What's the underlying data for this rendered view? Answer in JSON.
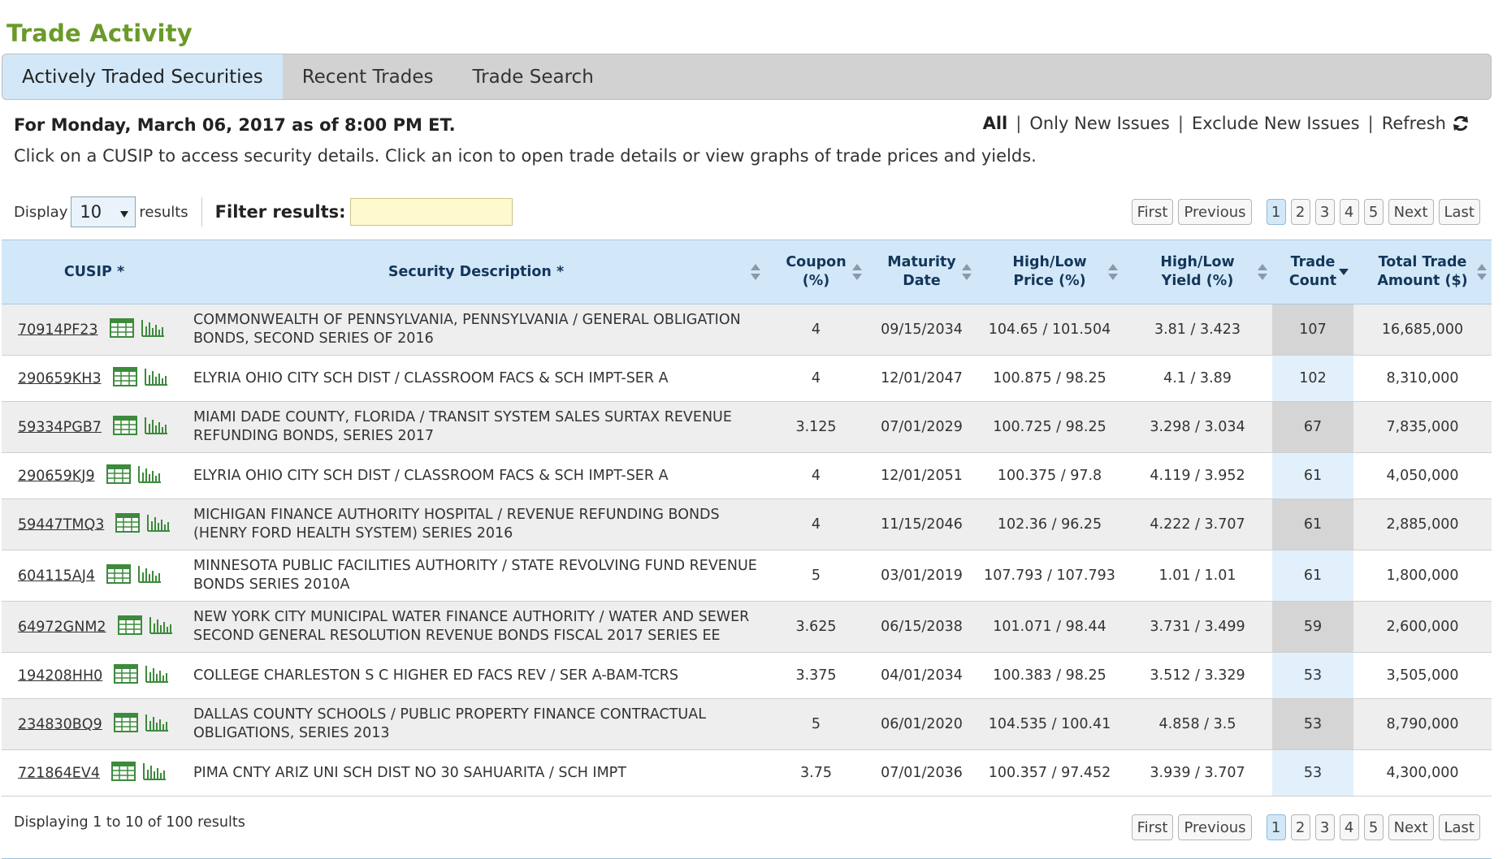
{
  "page": {
    "title": "Trade Activity"
  },
  "tabs": [
    {
      "label": "Actively Traded Securities",
      "active": true
    },
    {
      "label": "Recent Trades",
      "active": false
    },
    {
      "label": "Trade Search",
      "active": false
    }
  ],
  "summary": {
    "date_line": "For Monday, March 06, 2017 as of 8:00 PM ET.",
    "instructions": "Click on a CUSIP to access security details. Click an icon to open trade details or view graphs of trade prices and yields."
  },
  "issue_filter": {
    "all": "All",
    "separator": "|",
    "only_new": "Only New Issues",
    "exclude_new": "Exclude New Issues",
    "refresh": "Refresh",
    "refresh_icon": "refresh-icon"
  },
  "display": {
    "prefix": "Display",
    "selected": "10",
    "suffix": "results",
    "filter_label": "Filter results:",
    "filter_value": ""
  },
  "pagination": {
    "first": "First",
    "previous": "Previous",
    "pages": [
      "1",
      "2",
      "3",
      "4",
      "5"
    ],
    "current": "1",
    "next": "Next",
    "last": "Last"
  },
  "table": {
    "headers": {
      "cusip": "CUSIP *",
      "description": "Security Description *",
      "coupon_1": "Coupon",
      "coupon_2": "(%)",
      "maturity_1": "Maturity",
      "maturity_2": "Date",
      "price_1": "High/Low",
      "price_2": "Price (%)",
      "yield_1": "High/Low",
      "yield_2": "Yield (%)",
      "count_1": "Trade",
      "count_2": "Count",
      "amount_1": "Total Trade",
      "amount_2": "Amount ($)"
    },
    "sorted_column": "Trade Count",
    "sort_direction": "descending",
    "rows": [
      {
        "cusip": "70914PF23",
        "description": "COMMONWEALTH OF PENNSYLVANIA, PENNSYLVANIA / GENERAL OBLIGATION BONDS, SECOND SERIES OF 2016",
        "coupon": "4",
        "maturity": "09/15/2034",
        "price": "104.65 / 101.504",
        "yield": "3.81 / 3.423",
        "count": "107",
        "amount": "16,685,000"
      },
      {
        "cusip": "290659KH3",
        "description": "ELYRIA OHIO CITY SCH DIST / CLASSROOM FACS & SCH IMPT-SER A",
        "coupon": "4",
        "maturity": "12/01/2047",
        "price": "100.875 / 98.25",
        "yield": "4.1 / 3.89",
        "count": "102",
        "amount": "8,310,000"
      },
      {
        "cusip": "59334PGB7",
        "description": "MIAMI DADE COUNTY, FLORIDA / TRANSIT SYSTEM SALES SURTAX REVENUE REFUNDING BONDS, SERIES 2017",
        "coupon": "3.125",
        "maturity": "07/01/2029",
        "price": "100.725 / 98.25",
        "yield": "3.298 / 3.034",
        "count": "67",
        "amount": "7,835,000"
      },
      {
        "cusip": "290659KJ9",
        "description": "ELYRIA OHIO CITY SCH DIST / CLASSROOM FACS & SCH IMPT-SER A",
        "coupon": "4",
        "maturity": "12/01/2051",
        "price": "100.375 / 97.8",
        "yield": "4.119 / 3.952",
        "count": "61",
        "amount": "4,050,000"
      },
      {
        "cusip": "59447TMQ3",
        "description": "MICHIGAN FINANCE AUTHORITY HOSPITAL / REVENUE REFUNDING BONDS (HENRY FORD HEALTH SYSTEM) SERIES 2016",
        "coupon": "4",
        "maturity": "11/15/2046",
        "price": "102.36 / 96.25",
        "yield": "4.222 / 3.707",
        "count": "61",
        "amount": "2,885,000"
      },
      {
        "cusip": "604115AJ4",
        "description": "MINNESOTA PUBLIC FACILITIES AUTHORITY / STATE REVOLVING FUND REVENUE BONDS SERIES 2010A",
        "coupon": "5",
        "maturity": "03/01/2019",
        "price": "107.793 / 107.793",
        "yield": "1.01 / 1.01",
        "count": "61",
        "amount": "1,800,000"
      },
      {
        "cusip": "64972GNM2",
        "description": "NEW YORK CITY MUNICIPAL WATER FINANCE AUTHORITY / WATER AND SEWER SECOND GENERAL RESOLUTION REVENUE BONDS FISCAL 2017 SERIES EE",
        "coupon": "3.625",
        "maturity": "06/15/2038",
        "price": "101.071 / 98.44",
        "yield": "3.731 / 3.499",
        "count": "59",
        "amount": "2,600,000"
      },
      {
        "cusip": "194208HH0",
        "description": "COLLEGE CHARLESTON S C HIGHER ED FACS REV / SER A-BAM-TCRS",
        "coupon": "3.375",
        "maturity": "04/01/2034",
        "price": "100.383 / 98.25",
        "yield": "3.512 / 3.329",
        "count": "53",
        "amount": "3,505,000"
      },
      {
        "cusip": "234830BQ9",
        "description": "DALLAS COUNTY SCHOOLS / PUBLIC PROPERTY FINANCE CONTRACTUAL OBLIGATIONS, SERIES 2013",
        "coupon": "5",
        "maturity": "06/01/2020",
        "price": "104.535 / 100.41",
        "yield": "4.858 / 3.5",
        "count": "53",
        "amount": "8,790,000"
      },
      {
        "cusip": "721864EV4",
        "description": "PIMA CNTY ARIZ UNI SCH DIST NO 30 SAHUARITA / SCH IMPT",
        "coupon": "3.75",
        "maturity": "07/01/2036",
        "price": "100.357 / 97.452",
        "yield": "3.939 / 3.707",
        "count": "53",
        "amount": "4,300,000"
      }
    ],
    "row_icons": [
      "trade-details-icon",
      "price-yield-graph-icon"
    ]
  },
  "footer": {
    "displaying": "Displaying 1 to 10 of 100 results"
  },
  "colors": {
    "title_green": "#6a9a2a",
    "header_blue": "#d2e8f8",
    "header_text": "#14365a",
    "filter_yellow": "#fffacd",
    "icon_green": "#3c8a3c"
  }
}
